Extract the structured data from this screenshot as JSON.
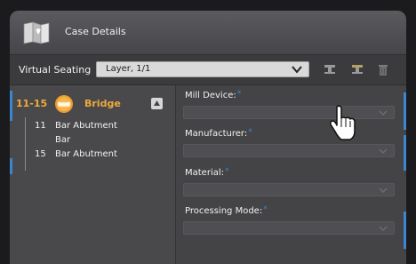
{
  "header": {
    "title": "Case Details"
  },
  "seating": {
    "label": "Virtual Seating",
    "layer_value": "Layer, 1/1"
  },
  "bridge": {
    "range": "11-15",
    "label": "Bridge"
  },
  "teeth": [
    {
      "num": "11",
      "name": "Bar Abutment"
    },
    {
      "num": "",
      "name": "Bar"
    },
    {
      "num": "15",
      "name": "Bar Abutment"
    }
  ],
  "fields": {
    "mill_device": {
      "label": "Mill Device:",
      "required_mark": "*",
      "value": ""
    },
    "manufacturer": {
      "label": "Manufacturer:",
      "required_mark": "*",
      "value": ""
    },
    "material": {
      "label": "Material:",
      "required_mark": "*",
      "value": ""
    },
    "processing_mode": {
      "label": "Processing Mode:",
      "required_mark": "*",
      "value": ""
    }
  },
  "colors": {
    "accent": "#3c86d0",
    "bridge_orange": "#f0a93b",
    "panel_bg": "#424245"
  }
}
